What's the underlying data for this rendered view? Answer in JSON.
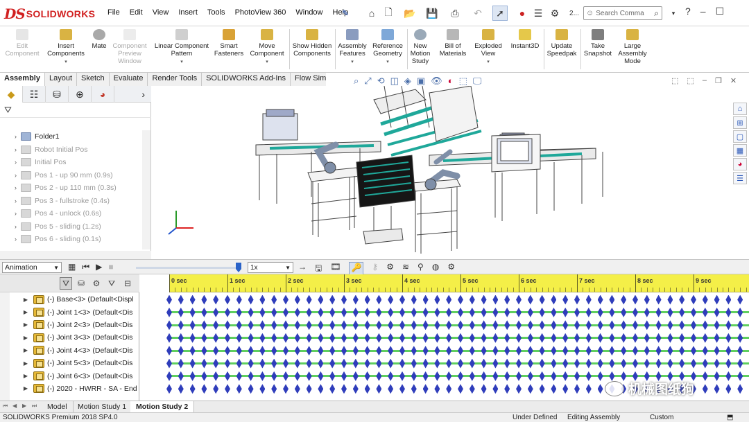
{
  "app": {
    "logo": "SOLIDWORKS",
    "logo_mark": "DS"
  },
  "menu": [
    "File",
    "Edit",
    "View",
    "Insert",
    "Tools",
    "PhotoView 360",
    "Window",
    "Help"
  ],
  "search": {
    "placeholder": "Search Comma"
  },
  "toolbar_counter": "2...",
  "ribbon": {
    "buttons": [
      {
        "label": "Edit Component",
        "disabled": true
      },
      {
        "label": "Insert Components",
        "disabled": false
      },
      {
        "label": "Mate",
        "disabled": false
      },
      {
        "label": "Component Preview Window",
        "disabled": true
      },
      {
        "label": "Linear Component Pattern",
        "disabled": false
      },
      {
        "label": "Smart Fasteners",
        "disabled": false
      },
      {
        "label": "Move Component",
        "disabled": false
      },
      {
        "label": "Show Hidden Components",
        "disabled": false
      },
      {
        "label": "Assembly Features",
        "disabled": false
      },
      {
        "label": "Reference Geometry",
        "disabled": false
      },
      {
        "label": "New Motion Study",
        "disabled": false
      },
      {
        "label": "Bill of Materials",
        "disabled": false
      },
      {
        "label": "Exploded View",
        "disabled": false
      },
      {
        "label": "Instant3D",
        "disabled": false
      },
      {
        "label": "Update Speedpak",
        "disabled": false
      },
      {
        "label": "Take Snapshot",
        "disabled": false
      },
      {
        "label": "Large Assembly Mode",
        "disabled": false
      }
    ]
  },
  "command_tabs": [
    "Assembly",
    "Layout",
    "Sketch",
    "Evaluate",
    "Render Tools",
    "SOLIDWORKS Add-Ins",
    "Flow Simulation"
  ],
  "feature_tree": [
    "Folder1",
    "Robot Initial Pos",
    "Initial Pos",
    "Pos 1 - up 90 mm (0.9s)",
    "Pos 2 - up 110 mm (0.3s)",
    "Pos 3 - fullstroke (0.4s)",
    "Pos 4 - unlock (0.6s)",
    "Pos 5 - sliding (1.2s)",
    "Pos 6 - sliding (0.1s)"
  ],
  "motion": {
    "study_type": "Animation",
    "speed": "1x",
    "time_labels": [
      "0 sec",
      "1 sec",
      "2 sec",
      "3 sec",
      "4 sec",
      "5 sec",
      "6 sec",
      "7 sec",
      "8 sec",
      "9 sec"
    ],
    "components": [
      "(-) Base<3> (Default<Displ",
      "(-) Joint 1<3> (Default<Dis",
      "(-) Joint 2<3> (Default<Dis",
      "(-) Joint 3<3> (Default<Dis",
      "(-) Joint 4<3> (Default<Dis",
      "(-) Joint 5<3> (Default<Dis",
      "(-) Joint 6<3> (Default<Dis",
      "(-) 2020 - HWRR - SA - End"
    ]
  },
  "bottom_tabs": [
    "Model",
    "Motion Study 1",
    "Motion Study 2"
  ],
  "status": {
    "version": "SOLIDWORKS Premium 2018 SP4.0",
    "definition": "Under Defined",
    "mode": "Editing Assembly",
    "units": "Custom"
  },
  "watermark": "机械图纸狗",
  "colors": {
    "brand": "#d12020",
    "ruler": "#f4ef48",
    "key": "#2f3dbb",
    "track": "#5fcf5f"
  }
}
